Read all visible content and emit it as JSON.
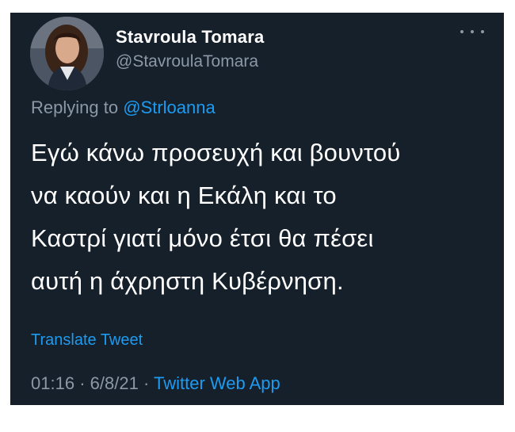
{
  "tweet": {
    "author": {
      "display_name": "Stavroula Tomara",
      "handle": "@StavroulaTomara",
      "avatar": "profile-photo"
    },
    "more_icon": "more-horizontal-icon",
    "reply": {
      "prefix": "Replying to",
      "mention": "@Strloanna"
    },
    "text_lines": [
      "Εγώ κάνω προσευχή και βουντού",
      "να καούν και η Εκάλη και το",
      "Καστρί γιατί μόνο έτσι θα πέσει",
      "αυτή η άχρηστη Κυβέρνηση."
    ],
    "translate_label": "Translate Tweet",
    "time": "01:16",
    "date": "6/8/21",
    "separator": "·",
    "source": "Twitter Web App"
  },
  "colors": {
    "background": "#15202b",
    "text": "#ffffff",
    "secondary": "#8b98a5",
    "link": "#1d9bf0"
  }
}
